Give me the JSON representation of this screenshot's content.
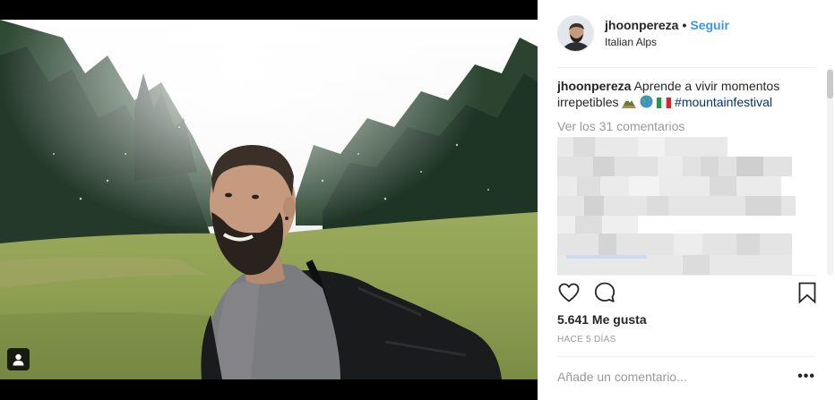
{
  "post": {
    "username": "jhoonpereza",
    "separator": "•",
    "follow_label": "Seguir",
    "location": "Italian Alps"
  },
  "caption": {
    "username": "jhoonpereza",
    "text": "Aprende a vivir momentos irrepetibles",
    "hashtag": "#mountainfestival"
  },
  "comments": {
    "view_all_label": "Ver los 31 comentarios"
  },
  "likes": {
    "label": "5.641 Me gusta"
  },
  "timestamp": "HACE 5 DÍAS",
  "add_comment": {
    "placeholder": "Añade un comentario...",
    "more_label": "•••"
  },
  "icons": {
    "like": "heart-icon",
    "comment": "comment-icon",
    "save": "bookmark-icon",
    "tag": "person-tag-icon"
  },
  "colors": {
    "link_blue": "#3897f0",
    "hashtag": "#003569",
    "muted": "#999999",
    "text": "#262626"
  }
}
